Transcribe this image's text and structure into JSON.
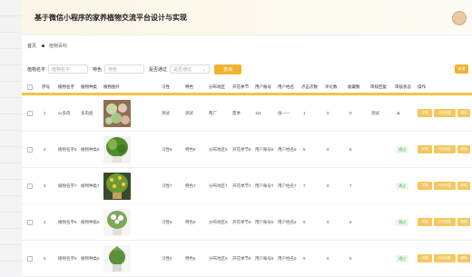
{
  "header": {
    "title": "基于微信小程序的家养植物交流平台设计与实现"
  },
  "breadcrumb": {
    "home": "首页",
    "current": "植物百科"
  },
  "search": {
    "fields": [
      {
        "label": "植物名字",
        "placeholder": "植物名字"
      },
      {
        "label": "特色",
        "placeholder": "特色"
      }
    ],
    "status_label": "是否通过",
    "status_placeholder": "是否通过",
    "search_button": "查询",
    "add_button": "新增"
  },
  "table": {
    "columns": [
      "序号",
      "植物名字",
      "植物种类",
      "植物图片",
      "习性",
      "特色",
      "分布地区",
      "开花季节",
      "用户账号",
      "用户姓名",
      "点击次数",
      "评论数",
      "收藏数",
      "审核回复",
      "审核状态",
      "操作"
    ],
    "rows": [
      {
        "index": "1",
        "name": "xx多肉",
        "type": "多肉类",
        "habit": "测试",
        "feature": "测试",
        "region": "两广",
        "season": "夏季",
        "account": "111",
        "username": "张——",
        "clicks": "1",
        "comments": "0",
        "favorites": "0",
        "reply": "测试",
        "status": "",
        "image": "succulent"
      },
      {
        "index": "2",
        "name": "植物名字8",
        "type": "植物种类8",
        "habit": "习性8",
        "feature": "特色8",
        "region": "分布地区8",
        "season": "开花季节8",
        "account": "用户账号8",
        "username": "用户姓名8",
        "clicks": "8",
        "comments": "0",
        "favorites": "8",
        "reply": "",
        "status": "通过",
        "image": "plant-green"
      },
      {
        "index": "3",
        "name": "植物名字7",
        "type": "植物种类7",
        "habit": "习性7",
        "feature": "特色7",
        "region": "分布地区7",
        "season": "开花季节7",
        "account": "用户账号7",
        "username": "用户姓名7",
        "clicks": "7",
        "comments": "0",
        "favorites": "7",
        "reply": "",
        "status": "通过",
        "image": "plant-yellow"
      },
      {
        "index": "4",
        "name": "植物名字6",
        "type": "植物种类6",
        "habit": "习性6",
        "feature": "特色6",
        "region": "分布地区6",
        "season": "开花季节6",
        "account": "用户账号6",
        "username": "用户姓名6",
        "clicks": "6",
        "comments": "0",
        "favorites": "6",
        "reply": "",
        "status": "通过",
        "image": "plant-white"
      },
      {
        "index": "5",
        "name": "植物名字5",
        "type": "植物种类5",
        "habit": "习性5",
        "feature": "特色5",
        "region": "分布地区5",
        "season": "开花季节5",
        "account": "用户账号5",
        "username": "用户姓名5",
        "clicks": "5",
        "comments": "0",
        "favorites": "5",
        "reply": "",
        "status": "通过",
        "image": "plant-pot"
      }
    ],
    "actions": [
      "详情",
      "评论回复",
      "删除"
    ]
  },
  "colors": {
    "accent": "#f2b230",
    "header_bg": "#fbf6e6",
    "status_green": "#58b35c"
  }
}
